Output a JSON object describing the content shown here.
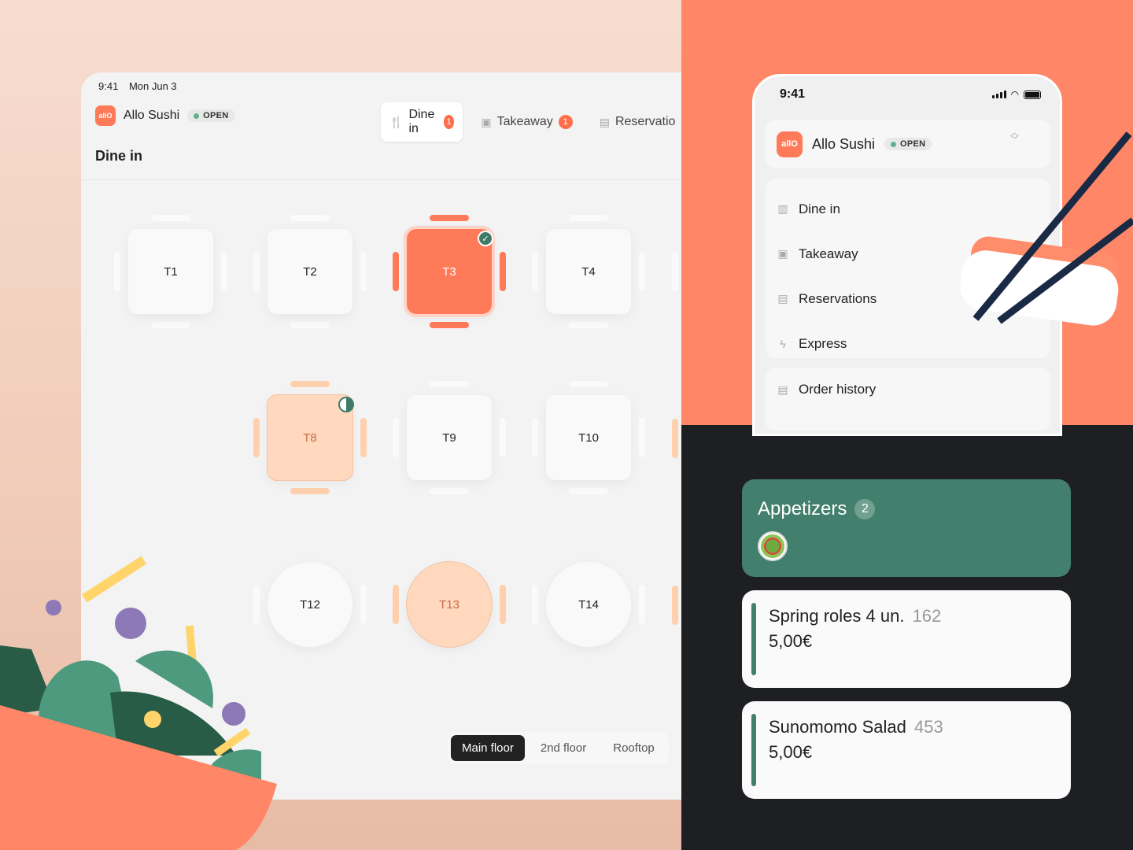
{
  "tablet": {
    "status_time": "9:41",
    "status_date": "Mon Jun 3",
    "brand": {
      "logo": "allO",
      "name": "Allo Sushi",
      "status": "OPEN"
    },
    "tabs": [
      {
        "label": "Dine in",
        "count": "1",
        "icon": "fork-knife-icon"
      },
      {
        "label": "Takeaway",
        "count": "1",
        "icon": "bag-icon"
      },
      {
        "label": "Reservatio",
        "icon": "book-icon"
      }
    ],
    "page_title": "Dine in",
    "tables": [
      {
        "label": "T1",
        "state": "free"
      },
      {
        "label": "T2",
        "state": "free"
      },
      {
        "label": "T3",
        "state": "selected"
      },
      {
        "label": "T4",
        "state": "free"
      },
      {
        "label": "T8",
        "state": "partial"
      },
      {
        "label": "T9",
        "state": "free"
      },
      {
        "label": "T10",
        "state": "free"
      },
      {
        "label": "T12",
        "state": "free"
      },
      {
        "label": "T13",
        "state": "partial"
      },
      {
        "label": "T14",
        "state": "free"
      }
    ],
    "floors": [
      {
        "label": "Main floor",
        "active": true
      },
      {
        "label": "2nd floor",
        "active": false
      },
      {
        "label": "Rooftop",
        "active": false
      }
    ]
  },
  "phone": {
    "time": "9:41",
    "brand": {
      "logo": "allO",
      "name": "Allo Sushi",
      "status": "OPEN"
    },
    "menu": [
      {
        "label": "Dine in",
        "icon": "table-icon"
      },
      {
        "label": "Takeaway",
        "icon": "bag-icon"
      },
      {
        "label": "Reservations",
        "icon": "book-icon"
      },
      {
        "label": "Express",
        "icon": "lightning-icon"
      }
    ],
    "history": {
      "label": "Order history",
      "icon": "receipt-icon"
    }
  },
  "menu_panel": {
    "category": {
      "title": "Appetizers",
      "count": "2"
    },
    "items": [
      {
        "name": "Spring roles 4 un.",
        "code": "162",
        "price": "5,00€"
      },
      {
        "name": "Sunomomo Salad",
        "code": "453",
        "price": "5,00€"
      }
    ]
  },
  "colors": {
    "accent": "#ff7a59",
    "green": "#42806d",
    "dark": "#1e1f23"
  }
}
